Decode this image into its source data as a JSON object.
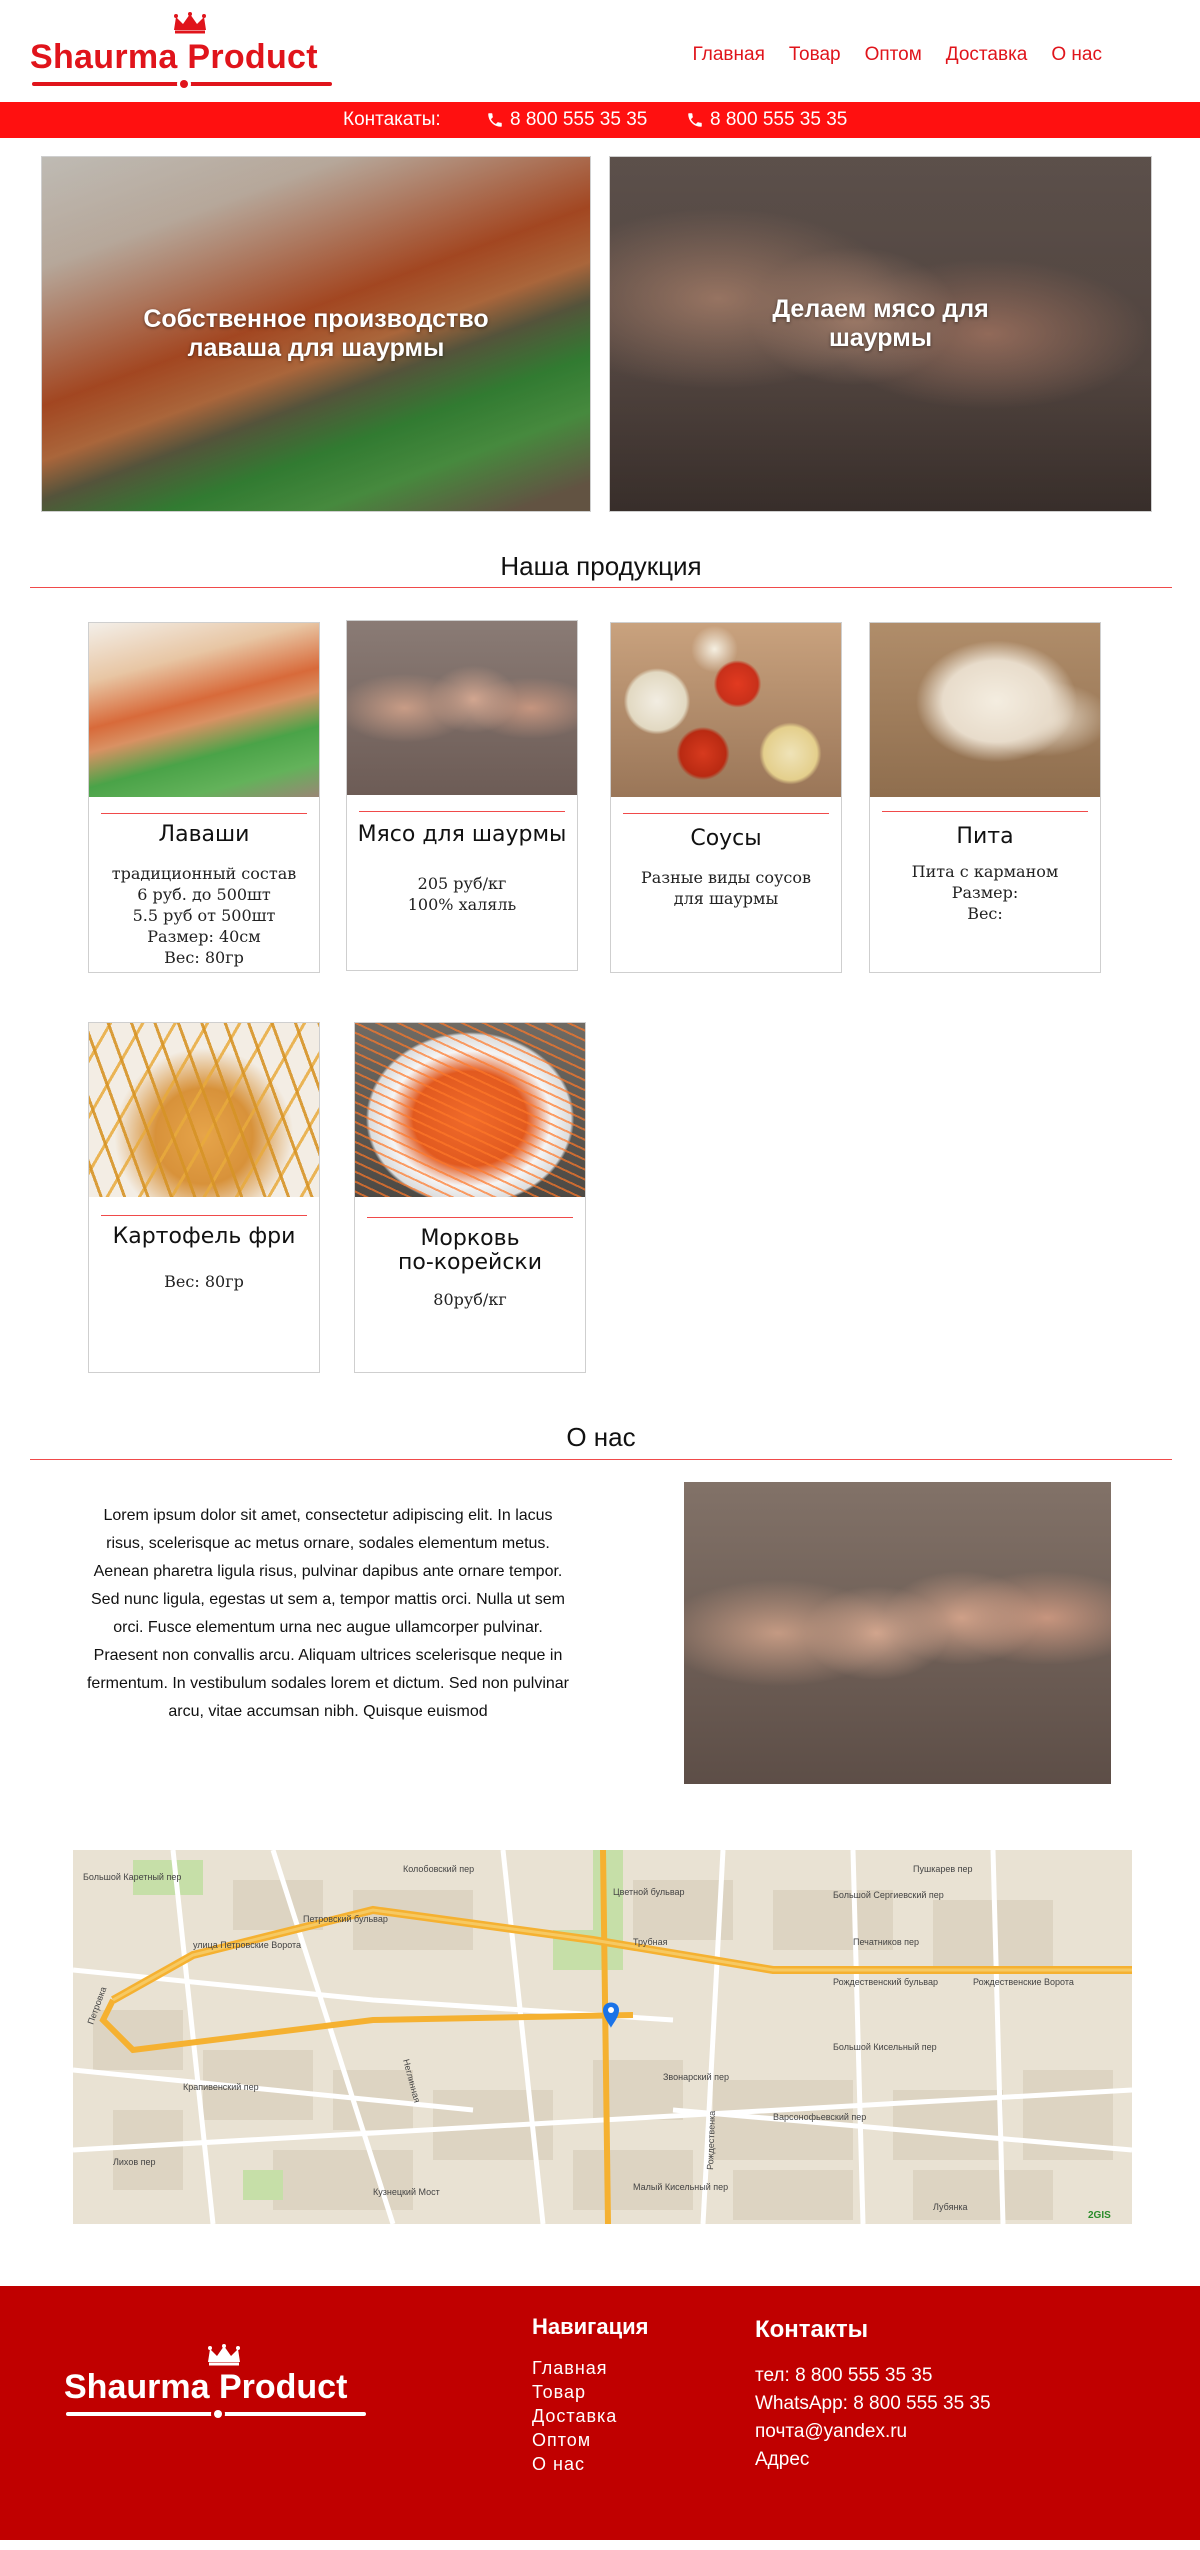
{
  "header": {
    "brand": "Shaurma Product",
    "nav": [
      "Главная",
      "Товар",
      "Оптом",
      "Доставка",
      "О нас"
    ]
  },
  "contact_bar": {
    "label": "Контакаты:",
    "phone1": "8 800 555 35 35",
    "phone2": "8 800 555 35 35"
  },
  "hero": [
    {
      "caption_line1": "Собственное производство",
      "caption_line2": "лаваша для шаурмы"
    },
    {
      "caption_line1": "Делаем мясо для",
      "caption_line2": "шаурмы"
    }
  ],
  "products_section": {
    "title": "Наша продукция",
    "items": [
      {
        "title": "Лаваши",
        "lines": [
          "традиционный состав",
          "6 руб. до 500шт",
          "5.5 руб от 500шт",
          "Размер: 40см",
          "Вес: 80гр"
        ]
      },
      {
        "title": "Мясо для шаурмы",
        "lines": [
          "205 руб/кг",
          "100% халяль"
        ]
      },
      {
        "title": "Соусы",
        "lines": [
          "Разные виды соусов",
          "для шаурмы"
        ]
      },
      {
        "title": "Пита",
        "lines": [
          "Пита с карманом",
          "Размер:",
          "Вес:"
        ]
      },
      {
        "title": "Картофель фри",
        "lines": [
          "Вес: 80гр"
        ]
      },
      {
        "title_line1": "Морковь",
        "title_line2": "по-корейски",
        "lines": [
          "80руб/кг"
        ]
      }
    ]
  },
  "about_section": {
    "title": "О нас",
    "text": "Lorem ipsum dolor sit amet, consectetur adipiscing elit. In lacus risus, scelerisque ac metus ornare, sodales elementum metus. Aenean pharetra ligula risus, pulvinar dapibus ante ornare tempor. Sed nunc ligula, egestas ut sem a, tempor mattis orci. Nulla ut sem orci. Fusce elementum urna nec augue ullamcorper pulvinar. Praesent non convallis arcu. Aliquam ultrices scelerisque neque in fermentum. In vestibulum sodales lorem et dictum. Sed non pulvinar arcu, vitae accumsan nibh. Quisque euismod"
  },
  "map": {
    "labels": [
      "Петровский бульвар",
      "Рождественский бульвар",
      "Большой Сергиевский пер",
      "Печатников пер",
      "Большой Кисельный пер",
      "Варсонофьевский пер",
      "Рождественка",
      "Неглинная",
      "Пушкарев пер",
      "Колобовский пер",
      "Крапивенский пер",
      "Звонарский пер",
      "Малый Кисельный пер",
      "Кузнецкий Мост",
      "Лубянка",
      "Трубная",
      "Цветной бульвар",
      "улица Петровские Ворота",
      "Рождественские Ворота",
      "Лихов пер",
      "Большой Каретный пер",
      "Петровка"
    ],
    "attribution": "2GIS"
  },
  "footer": {
    "brand": "Shaurma Product",
    "nav_title": "Навигация",
    "nav": [
      "Главная",
      "Товар",
      "Доставка",
      "Оптом",
      "О нас"
    ],
    "contacts_title": "Контакты",
    "contacts": [
      "тел: 8 800 555 35 35",
      "WhatsApp: 8 800 555 35 35",
      "почта@yandex.ru",
      "Адрес"
    ]
  },
  "colors": {
    "brand_red": "#e0141b",
    "bar_red": "#ff1010",
    "footer_red": "#c00000",
    "accent_line": "#f04a4a"
  }
}
